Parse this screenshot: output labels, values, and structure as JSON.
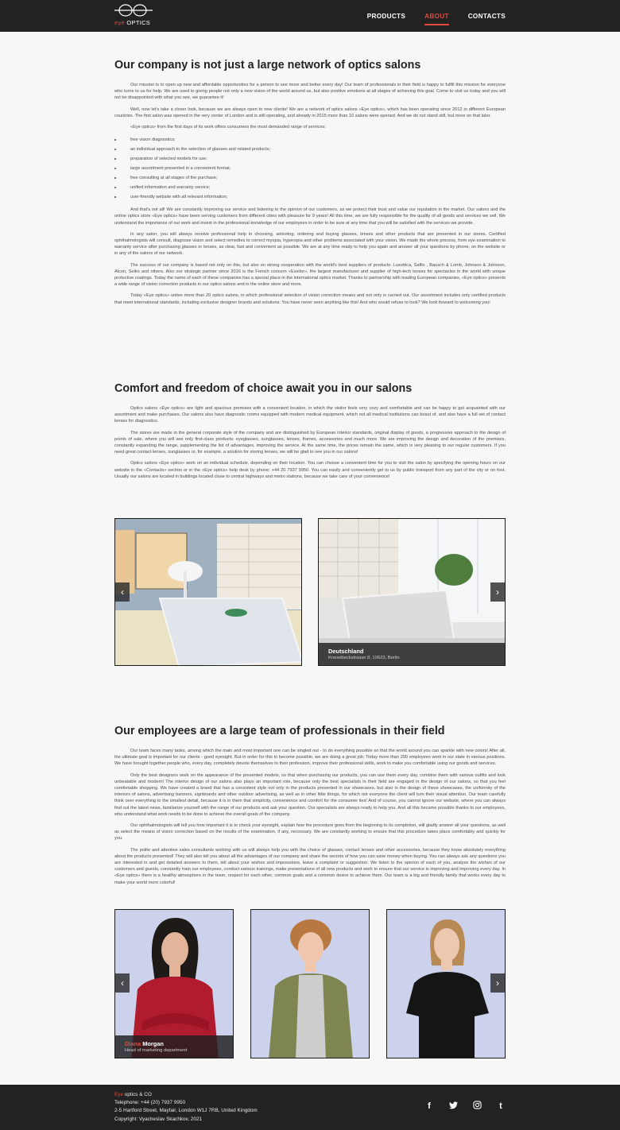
{
  "header": {
    "logo": {
      "word1": "eye",
      "word2": " OPTICS"
    },
    "nav": [
      {
        "label": "PRODUCTS"
      },
      {
        "label": "ABOUT"
      },
      {
        "label": "CONTACTS"
      }
    ],
    "active_color": "#e24a3b"
  },
  "section1": {
    "title": "Our company is not just a large network of optics salons",
    "p1": "Our mission is to open up new and affordable opportunities for a person to see more and better every day! Our team of professionals in their field is happy to fulfill this mission for everyone who turns to us for help. We are used to giving people not only a new vision of the world around us, but also positive emotions at all stages of achieving this goal. Come to visit us today and you will not be disappointed with what you see, we guarantee it!",
    "p2": "Well, now let's take a closer look, because we are always open to new clients! We are a network of optics salons «Eye optics», which has been operating since 2012 in different European countries. The first salon was opened in the very center of London and is still operating, and already in 2015 more than 10 salons were opened. And we do not stand still, but more on that later.",
    "p3": "«Eye optics» from the first days of its work offers consumers the most demanded range of services:",
    "services": [
      "free vision diagnostics;",
      "an individual approach to the selection of glasses and related products;",
      "preparation of selected models for use;",
      "large assortment presented in a convenient format;",
      "free consulting at all stages of the purchase;",
      "unified information and warranty service;",
      "user-friendly website with all relevant information;"
    ],
    "p4": "And that's not all! We are constantly improving our service and listening to the opinion of our customers, as we protect their trust and value our reputation in the market. Our salons and the online optics store «Eye optics» have been serving customers from different cities with pleasure for 9 years! All this time, we are fully responsible for the quality of all goods and services we sell. We understand the importance of our work and invest in the professional knowledge of our employees in order to be sure at any time that you will be satisfied with the services we provide.",
    "p5": "In any salon, you will always receive professional help in choosing, selecting, ordering and buying glasses, lenses and other products that are presented in our stores. Certified ophthalmologists will consult, diagnose vision and select remedies to correct myopia, hyperopia and other problems associated with your vision. We made the whole process, from eye examination to warranty service after purchasing glasses or lenses, as clear, fast and convenient as possible. We are at any time ready to help you again and answer all your questions by phone, on the website or in any of the salons of our network.",
    "p6": "The success of our company is based not only on this, but also on strong cooperation with the world's best suppliers of products: Luxottica, Safilo , Bausch & Lomb, Johnson & Johnson, Alcon, Seiko and others. Also our strategic partner since 2016 is the French concern «Essilor», the largest manufacturer and supplier of high-tech lenses for spectacles in the world with unique protective coatings. Today the name of each of these companies has a special place in the international optics market. Thanks to partnership with leading European companies, «Eye optics» presents a wide range of vision correction products in our optics salons and in the online store and more.",
    "p7": "Today «Eye optics» unites more than 20 optics salons, in which professional selection of vision correction means and not only is carried out. Our assortment includes only certified products that meet international standards, including exclusive designer brands and solutions. You have never seen anything like this! And who would refuse to look? We look forward to welcoming you!"
  },
  "section2": {
    "title": "Comfort and freedom of choice await you in our salons",
    "p1": "Optics salons «Eye optics» are light and spacious premises with a convenient location, in which the visitor feels very cozy and comfortable and can be happy to get acquainted with our assortment and make purchases. Our salons also have diagnostic rooms equipped with modern medical equipment, which not all medical institutions can boast of, and also have a full set of contact lenses for diagnostics.",
    "p2": "The stores are made in the general corporate style of the company and are distinguished by European interior standards, original display of goods, a progressive approach to the design of points of sale, where you will see only first-class products: eyeglasses, sunglasses, lenses, frames, accessories and much more. We are improving the design and decoration of the premises, constantly expanding the range, supplementing the list of advantages, improving the service. At the same time, the prices remain the same, which is very pleasing to our regular customers. If you need great contact lenses, sunglasses or, for example, a solution for storing lenses, we will be glad to see you in our salons!",
    "p3": "Optics salons «Eye optics» work on an individual schedule, depending on their location. You can choose a convenient time for you to visit the salon by specifying the opening hours on our website in the «Contacts» section or in the «Eye optics» help desk by phone: +44 20 7937 9950. You can easily and conveniently get to us by public transport from any part of the city or on foot. Usually our salons are located in buildings located close to central highways and metro stations, because we take care of your convenience!",
    "gallery": {
      "caption_title": "Deutschland",
      "caption_sub": "Knesebeckstrasse 8, 10623, Berlin",
      "prev_icon": "chevron-left-icon",
      "next_icon": "chevron-right-icon"
    }
  },
  "section3": {
    "title": "Our employees are a large team of professionals in their field",
    "p1": "Our team faces many tasks, among which the main and most important one can be singled out - to do everything possible so that the world around you can sparkle with new colors! After all, the ultimate goal is important for our clients - good eyesight. But in order for this to become possible, we are doing a great job. Today more than 200 employees work in our state in various positions. We have brought together people who, every day, completely devote themselves to their profession, improve their professional skills, work to make you comfortable using our goods and services.",
    "p2": "Only the best designers work on the appearance of the presented models, so that when purchasing our products, you can use them every day, combine them with various outfits and look unbeatable and modern! The interior design of our salons also plays an important role, because only the best specialists in their field are engaged in the design of our salons, so that you feel comfortable shopping. We have created a brand that has a consistent style not only in the products presented in our showcases, but also in the design of these showcases, the uniformity of the interiors of salons, advertising banners, signboards and other outdoor advertising, as well as in other little things, for which not everyone the client will turn their visual attention. Our team carefully think over everything to the smallest detail, because it is in them that simplicity, convenience and comfort for the consumer lies! And of course, you cannot ignore our website, where you can always find out the latest news, familiarize yourself with the range of our products and ask your question. Our specialists are always ready to help you. And all this became possible thanks to our employees, who understand what work needs to be done to achieve the overall goals of the company.",
    "p3": "Our ophthalmologists will tell you how important it is to check your eyesight, explain how the procedure goes from the beginning to its completion, will gladly answer all your questions, as well as select the means of vision correction based on the results of the examination, if any, necessary. We are constantly working to ensure that this procedure takes place comfortably and quickly for you.",
    "p4": "The polite and attentive sales consultants working with us will always help you with the choice of glasses, contact lenses and other accessories, because they know absolutely everything about the products presented! They will also tell you about all the advantages of our company and share the secrets of how you can save money when buying. You can always ask any questions you are interested in and get detailed answers to them, tell about your wishes and impressions, leave a complaint or suggestion. We listen to the opinion of each of you, analyze the wishes of our customers and guests, constantly train our employees, conduct various trainings, make presentations of all new products and work to ensure that our service is improving and improving every day. In «Eye optics» there is a healthy atmosphere in the team, respect for each other, common goals and a common desire to achieve them. Our team is a big and friendly family that works every day to make your world more colorful!",
    "employee": {
      "first_name": "Diana",
      "last_name": " Morgan",
      "position": "Head of marketing department"
    }
  },
  "footer": {
    "brand_red": "Eye",
    "brand_rest": " optics & CO",
    "telephone": "Telephone: +44 (20) 7937 9950",
    "address": "2-5 Hartford Street, Mayfair, London W1J 7RB, United Kingdom",
    "copyright": "Copyright: Vyacheslav Skachkov, 2021",
    "social": [
      "facebook-icon",
      "twitter-icon",
      "instagram-icon",
      "tumblr-icon"
    ]
  }
}
